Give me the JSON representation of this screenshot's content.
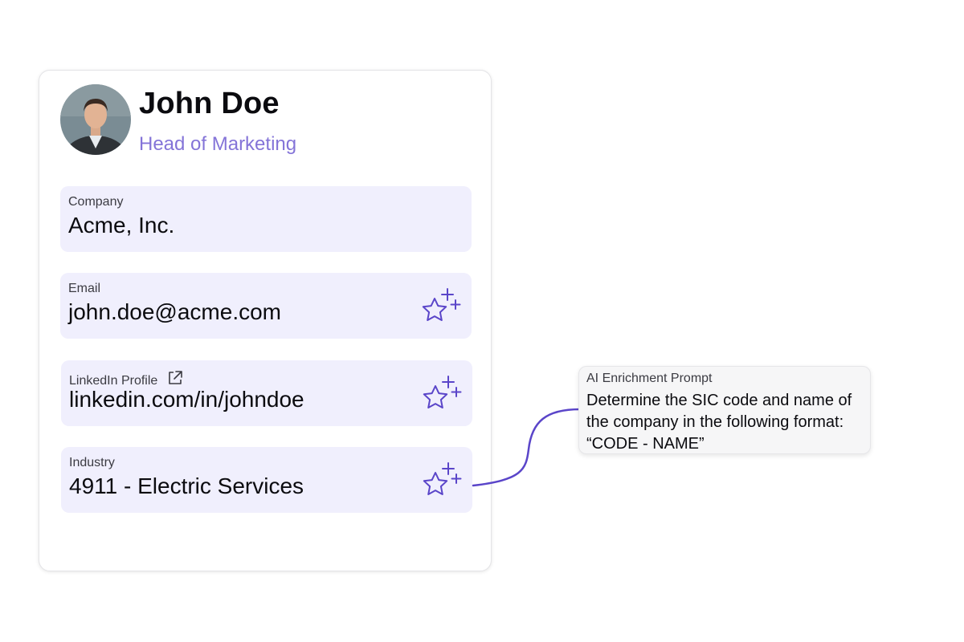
{
  "contact": {
    "name": "John Doe",
    "title": "Head of Marketing"
  },
  "fields": [
    {
      "label": "Company",
      "value": "Acme, Inc.",
      "ai_enriched": false
    },
    {
      "label": "Email",
      "value": "john.doe@acme.com",
      "ai_enriched": true
    },
    {
      "label": "LinkedIn Profile",
      "value": "linkedin.com/in/johndoe",
      "ai_enriched": true,
      "icon": "external-link-icon"
    },
    {
      "label": "Industry",
      "value": "4911 - Electric Services",
      "ai_enriched": true
    }
  ],
  "prompt": {
    "label": "AI Enrichment Prompt",
    "text": "Determine the SIC code and name of the company in the following format: “CODE - NAME”"
  },
  "icons": {
    "avatar": "person-photo",
    "sparkle": "sparkle-star-icon",
    "external": "external-link-icon"
  },
  "colors": {
    "accent": "#5a45c9",
    "title": "#8474d8",
    "field_bg": "#f0effd"
  }
}
